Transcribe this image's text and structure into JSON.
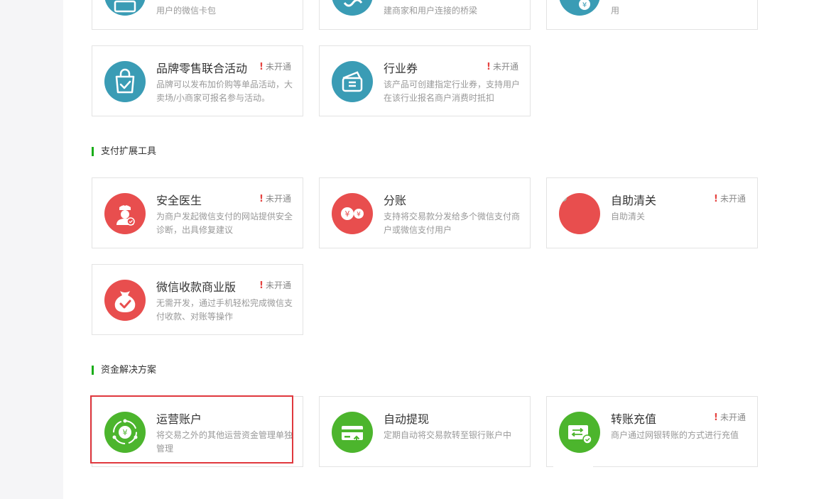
{
  "colors": {
    "teal": "#3a9cb5",
    "red": "#e84e4e",
    "green": "#4cb52d",
    "section_bar": "#1aad19",
    "highlight": "#e0383e",
    "warn": "#e64340"
  },
  "top_partial": [
    {
      "desc": "用户的微信卡包",
      "icon": "card-icon"
    },
    {
      "desc": "建商家和用户连接的桥梁",
      "icon": "link-icon"
    },
    {
      "desc": "用",
      "icon": "coin-icon"
    }
  ],
  "marketing_cards": [
    {
      "title": "品牌零售联合活动",
      "desc": "品牌可以发布加价购等单品活动，大卖场/小商家可报名参与活动。",
      "status": "未开通",
      "icon": "shopping-bag-icon"
    },
    {
      "title": "行业券",
      "desc": "该产品可创建指定行业券，支持用户在该行业报名商户消费时抵扣",
      "status": "未开通",
      "icon": "wallet-icon"
    }
  ],
  "sections": {
    "payment_tools": "支付扩展工具",
    "fund_solutions": "资金解决方案"
  },
  "payment_tools": [
    {
      "title": "安全医生",
      "desc": "为商户发起微信支付的网站提供安全诊断，出具修复建议",
      "status": "未开通",
      "icon": "doctor-icon"
    },
    {
      "title": "分账",
      "desc": "支持将交易款分发给多个微信支付商户或微信支付用户",
      "status": "",
      "icon": "split-yuan-icon"
    },
    {
      "title": "自助清关",
      "desc": "自助清关",
      "status": "未开通",
      "icon": "customs-icon"
    },
    {
      "title": "微信收款商业版",
      "desc": "无需开发，通过手机轻松完成微信支付收款、对账等操作",
      "status": "未开通",
      "icon": "money-bag-icon"
    }
  ],
  "fund_solutions": [
    {
      "title": "运营账户",
      "desc": "将交易之外的其他运营资金管理单独管理",
      "status": "",
      "icon": "yuan-cycle-icon"
    },
    {
      "title": "自动提现",
      "desc": "定期自动将交易款转至银行账户中",
      "status": "",
      "icon": "card-withdraw-icon"
    },
    {
      "title": "转账充值",
      "desc": "商户通过网银转账的方式进行充值",
      "status": "未开通",
      "icon": "transfer-card-icon"
    }
  ]
}
